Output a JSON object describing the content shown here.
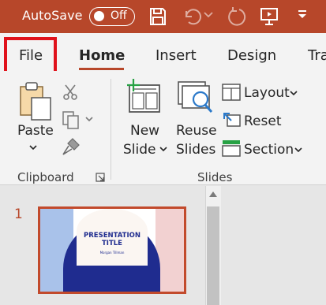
{
  "titlebar": {
    "autosave_label": "AutoSave",
    "autosave_state": "Off",
    "icons": [
      "save-icon",
      "undo-icon",
      "undo-dropdown-icon",
      "redo-icon",
      "present-icon",
      "customize-toolbar-icon"
    ]
  },
  "tabs": [
    {
      "label": "File",
      "active": false,
      "highlighted": true
    },
    {
      "label": "Home",
      "active": true
    },
    {
      "label": "Insert",
      "active": false
    },
    {
      "label": "Design",
      "active": false
    },
    {
      "label": "Tra",
      "active": false
    }
  ],
  "ribbon": {
    "clipboard": {
      "group_label": "Clipboard",
      "paste_label": "Paste",
      "cut_icon": "scissors-icon",
      "copy_icon": "copy-icon",
      "format_painter_icon": "paintbrush-icon",
      "launcher_icon": "dialog-launcher-icon"
    },
    "slides": {
      "group_label": "Slides",
      "new_slide_line1": "New",
      "new_slide_line2": "Slide",
      "reuse_slides_line1": "Reuse",
      "reuse_slides_line2": "Slides",
      "layout_label": "Layout",
      "reset_label": "Reset",
      "section_label": "Section"
    }
  },
  "slide_panel": {
    "slides": [
      {
        "number": "1",
        "title_line1": "PRESENTATION",
        "title_line2": "TITLE",
        "subtitle": "Morgan Tillman",
        "selected": true
      }
    ]
  },
  "colors": {
    "accent": "#b7472a",
    "file_highlight": "#e0121b",
    "thumb_blue": "#1f2c8f",
    "thumb_left": "#a9c2ea",
    "thumb_right": "#f2d1d1"
  }
}
